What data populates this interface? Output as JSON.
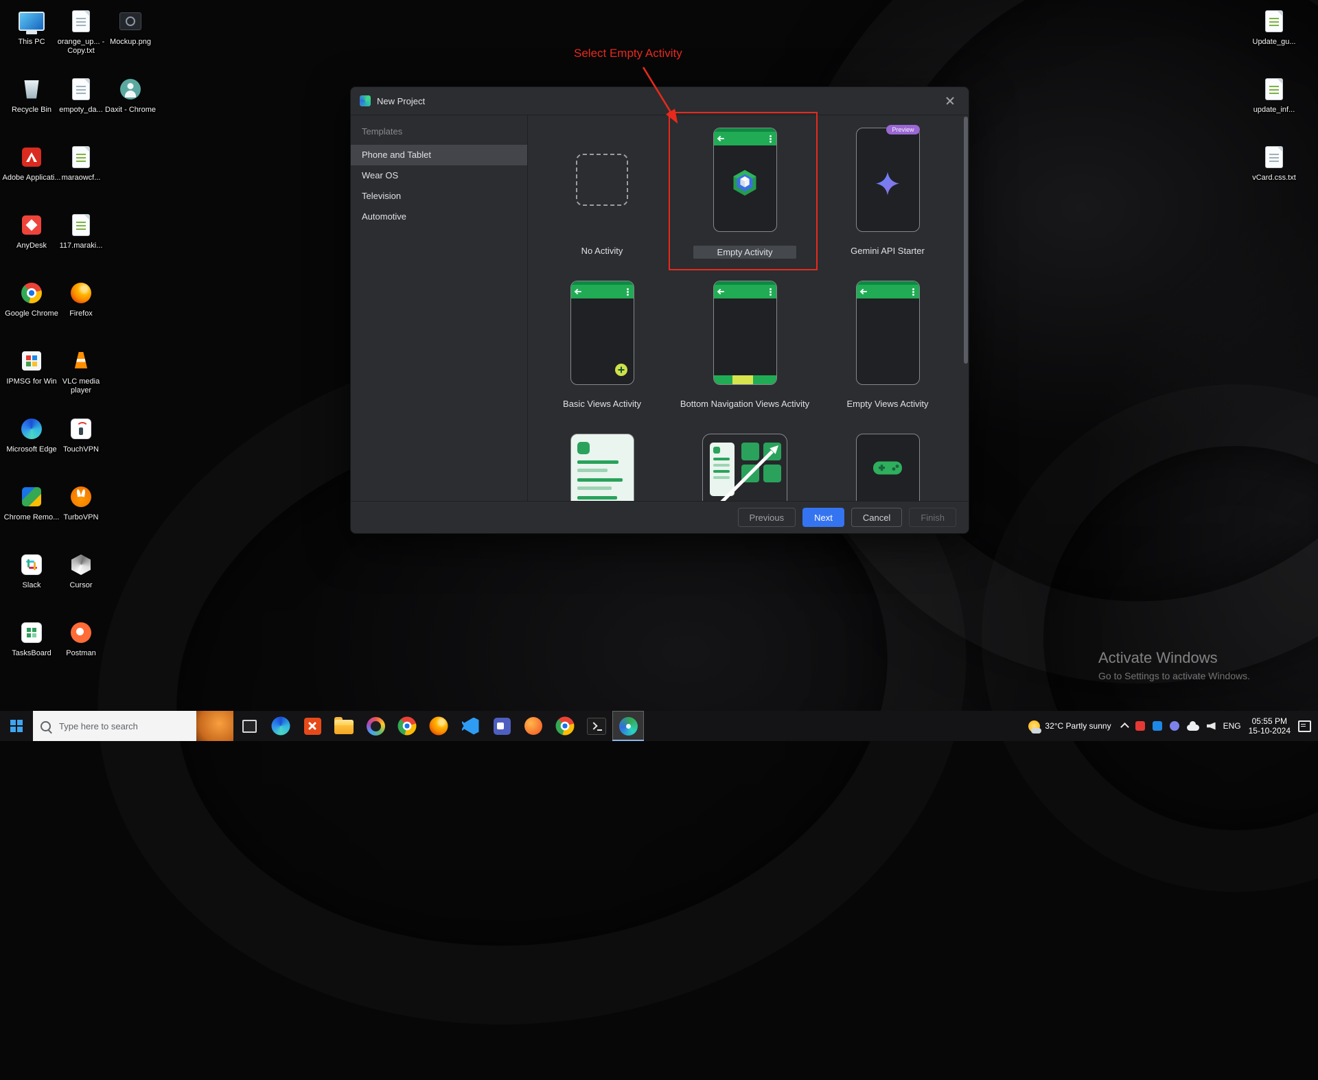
{
  "annotation": {
    "label": "Select Empty Activity"
  },
  "desktop": {
    "left_icons": [
      {
        "label": "This PC"
      },
      {
        "label": "Recycle Bin"
      },
      {
        "label": "Adobe Applicati..."
      },
      {
        "label": "AnyDesk"
      },
      {
        "label": "Google Chrome"
      },
      {
        "label": "IPMSG for Win"
      },
      {
        "label": "Microsoft Edge"
      },
      {
        "label": "Chrome Remo..."
      },
      {
        "label": "Slack"
      },
      {
        "label": "TasksBoard"
      }
    ],
    "mid_icons": [
      {
        "label": "orange_up... - Copy.txt"
      },
      {
        "label": "empoty_da..."
      },
      {
        "label": "maraowcf..."
      },
      {
        "label": "117.maraki..."
      },
      {
        "label": "Firefox"
      },
      {
        "label": "VLC media player"
      },
      {
        "label": "TouchVPN"
      },
      {
        "label": "TurboVPN"
      },
      {
        "label": "Cursor"
      },
      {
        "label": "Postman"
      }
    ],
    "third_icons": [
      {
        "label": "Mockup.png"
      },
      {
        "label": "Daxit - Chrome"
      }
    ],
    "right_icons": [
      {
        "label": "Update_gu..."
      },
      {
        "label": "update_inf..."
      },
      {
        "label": "vCard.css.txt"
      }
    ],
    "watermark_line1": "Activate Windows",
    "watermark_line2": "Go to Settings to activate Windows."
  },
  "dialog": {
    "title": "New Project",
    "sidebar_header": "Templates",
    "sidebar_items": [
      {
        "label": "Phone and Tablet"
      },
      {
        "label": "Wear OS"
      },
      {
        "label": "Television"
      },
      {
        "label": "Automotive"
      }
    ],
    "templates": [
      {
        "name": "No Activity"
      },
      {
        "name": "Empty Activity"
      },
      {
        "name": "Gemini API Starter",
        "badge": "Preview"
      },
      {
        "name": "Basic Views Activity"
      },
      {
        "name": "Bottom Navigation Views Activity"
      },
      {
        "name": "Empty Views Activity"
      }
    ],
    "buttons": {
      "previous": "Previous",
      "next": "Next",
      "cancel": "Cancel",
      "finish": "Finish"
    }
  },
  "taskbar": {
    "search_placeholder": "Type here to search",
    "tray": {
      "weather": "32°C Partly sunny",
      "language": "ENG",
      "time": "05:55 PM",
      "date": "15-10-2024"
    }
  }
}
